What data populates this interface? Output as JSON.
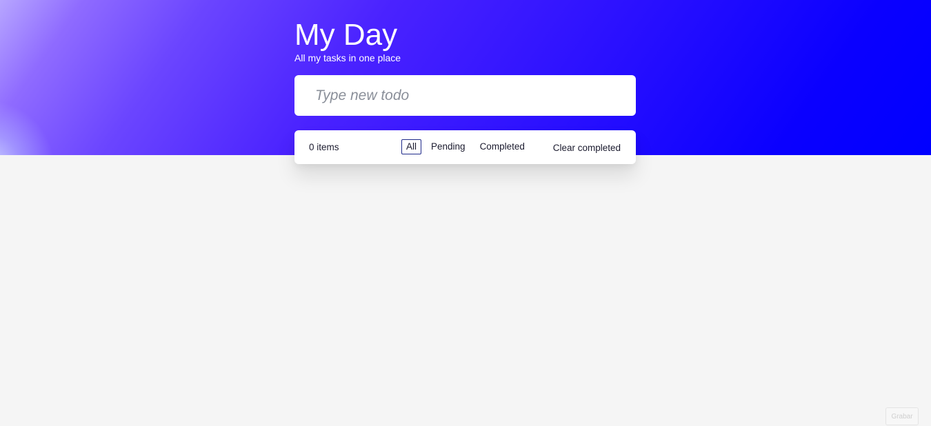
{
  "header": {
    "title": "My Day",
    "subtitle": "All my tasks in one place"
  },
  "new_todo": {
    "placeholder": "Type new todo",
    "value": ""
  },
  "footer": {
    "count_label": "0 items",
    "filters": [
      {
        "label": "All",
        "selected": true
      },
      {
        "label": "Pending",
        "selected": false
      },
      {
        "label": "Completed",
        "selected": false
      }
    ],
    "clear_label": "Clear completed"
  },
  "record_button": {
    "label": "Grabar"
  },
  "colors": {
    "hero_start": "#b7a6ff",
    "hero_end": "#0000ff",
    "background": "#f5f5f5",
    "selected_filter_border": "#1f2a8a",
    "placeholder_text": "#8a8f99"
  }
}
